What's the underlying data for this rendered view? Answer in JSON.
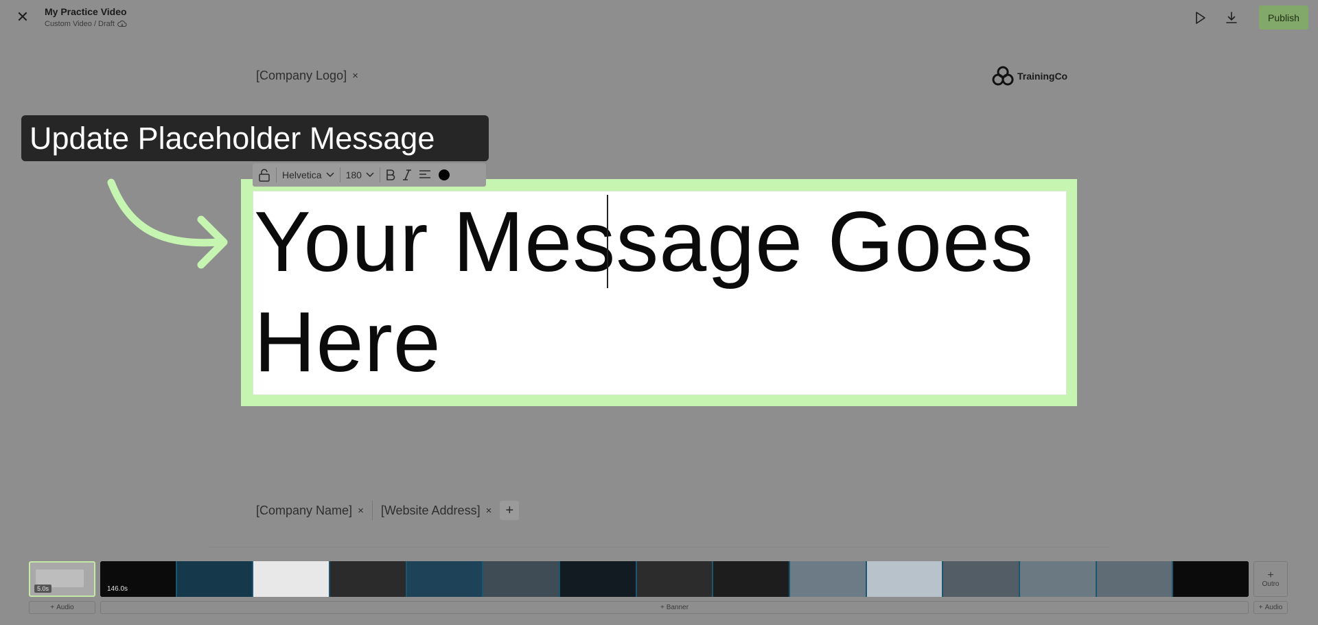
{
  "header": {
    "close_icon": "close-icon",
    "title": "My Practice Video",
    "subtitle": "Custom Video / Draft",
    "cloud_icon": "cloud-sync-icon",
    "play_icon": "play-icon",
    "download_icon": "download-icon",
    "publish_label": "Publish"
  },
  "canvas": {
    "logo_placeholder": "[Company Logo]",
    "remove_glyph": "×",
    "brand_name": "TrainingCo",
    "brand_icon": "trainingco-logo-icon",
    "message_text": "Your Message Goes Here",
    "company_name": "[Company Name]",
    "website": "[Website Address]",
    "add_glyph": "+"
  },
  "callout": {
    "text": "Update Placeholder Message",
    "arrow_icon": "curved-arrow-icon",
    "accent_color": "#c5f5b0"
  },
  "toolbar": {
    "lock_icon": "unlock-icon",
    "font_family": "Helvetica",
    "font_size": "180",
    "bold_icon": "bold-icon",
    "italic_icon": "italic-icon",
    "align_icon": "align-left-icon",
    "color_icon": "color-swatch-icon",
    "text_color": "#000000"
  },
  "timeline": {
    "intro_duration": "5.0s",
    "main_duration": "146.0s",
    "outro_label": "Outro",
    "add_audio_label": "Audio",
    "add_banner_label": "Banner",
    "plus_glyph": "+",
    "frame_count": 15,
    "strip_accent": "#1a5672"
  }
}
